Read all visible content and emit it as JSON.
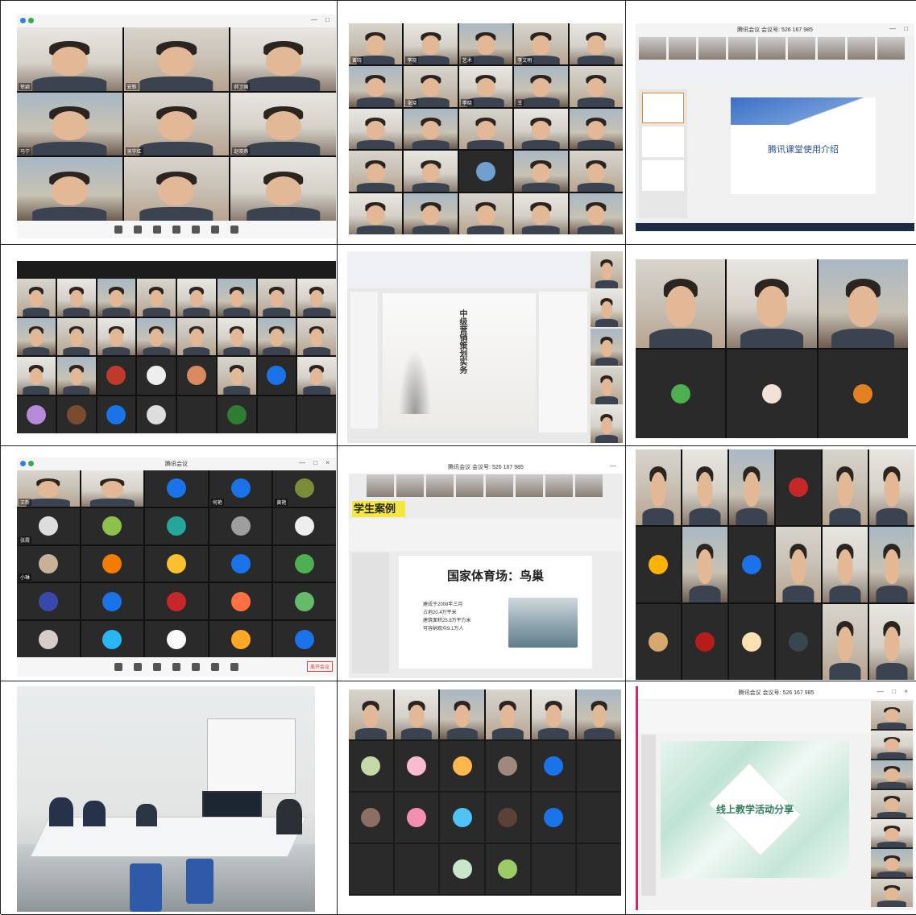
{
  "panels": {
    "p1": {
      "names": [
        "徐颖",
        "安新",
        "郝卫国",
        "马宁",
        "吴宇红",
        "赵晓燕",
        "",
        "",
        ""
      ]
    },
    "p2": {
      "names": [
        "黄晓",
        "李晓",
        "艺术",
        "李文明",
        "",
        "",
        "张晓",
        "李晓",
        "王",
        ""
      ],
      "video_label": ""
    },
    "p3": {
      "title": "腾讯会议 会议号: 526 167 985",
      "slide_title": "腾讯课堂使用介绍"
    },
    "p4": {
      "names": [
        "",
        "",
        "",
        "",
        "",
        "",
        "",
        ""
      ]
    },
    "p5": {
      "slide_vertical_title": "中级营销策划实务"
    },
    "p6": {
      "names": [
        "",
        "",
        ""
      ]
    },
    "p7": {
      "title": "腾讯会议",
      "names": [
        "王新",
        "",
        "",
        "何艳",
        "黄艳",
        "张霞",
        "",
        "",
        "",
        "",
        "小琳",
        "",
        "",
        "",
        "",
        ""
      ],
      "leave_label": "离开会议"
    },
    "p8": {
      "title": "腾讯会议 会议号: 526 167 985",
      "banner": "学生案例",
      "slide_title": "国家体育场：鸟巢",
      "bullets": [
        "建成于2008年三月",
        "占地20.4万平米",
        "建筑面积25.8万平方米",
        "可容纳观众9.1万人"
      ]
    },
    "p9": {
      "names": [
        "",
        "",
        "",
        "",
        "",
        "",
        "",
        "",
        "",
        "",
        "",
        "",
        "",
        "",
        "",
        "",
        "",
        ""
      ]
    },
    "p10": {
      "caption": ""
    },
    "p11": {
      "names": []
    },
    "p12": {
      "title": "腾讯会议 会议号: 526 167 985",
      "slide_title": "线上教学活动分享"
    }
  }
}
